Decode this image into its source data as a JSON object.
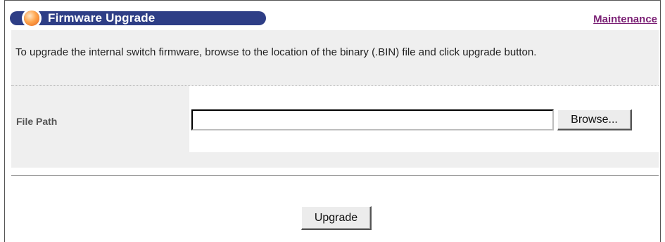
{
  "header": {
    "title": "Firmware Upgrade",
    "link": "Maintenance",
    "icon": "orange-circle-icon"
  },
  "description": "To upgrade the internal switch firmware, browse to the location of the binary (.BIN) file and click upgrade button.",
  "form": {
    "file_path_label": "File Path",
    "file_path_value": "",
    "browse_label": "Browse...",
    "upgrade_label": "Upgrade"
  },
  "colors": {
    "title_bar": "#2e3e86",
    "link": "#7a1f74",
    "panel": "#efefef"
  }
}
